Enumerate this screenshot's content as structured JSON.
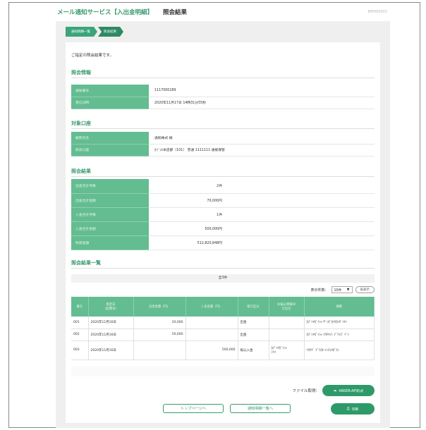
{
  "header": {
    "service_title": "メール通知サービス【入出金明細】",
    "page_title": "照会結果",
    "screen_code": "BMH00003"
  },
  "breadcrumb": [
    "通知明細一覧",
    "照会結果"
  ],
  "intro_text": "ご指定の照会結果です。",
  "sections": {
    "inquiry_info": "照会情報",
    "target_account": "対象口座",
    "inquiry_result": "照会結果",
    "result_list": "照会結果一覧"
  },
  "inquiry_info": [
    {
      "label": "通知番号",
      "value": "1117000189"
    },
    {
      "label": "受信日時",
      "value": "2020年11月17日 14時31分55秒"
    }
  ],
  "target_account": [
    {
      "label": "顧客氏名",
      "value": "通知株式 様"
    },
    {
      "label": "照会口座",
      "value": "ｶﾌﾞｼｷ本店部（101） 普通 1111111 通帳保管"
    }
  ],
  "inquiry_result": [
    {
      "label": "出金合計件数",
      "value": "2件"
    },
    {
      "label": "出金合計金額",
      "value": "70,000円"
    },
    {
      "label": "入金合計件数",
      "value": "1件"
    },
    {
      "label": "入金合計金額",
      "value": "500,000円"
    },
    {
      "label": "残高金額",
      "value": "512,820,848円"
    }
  ],
  "list": {
    "total": "全3件",
    "display_count_label": "表示件数：",
    "display_count_value": "10件",
    "redisplay_label": "再表示",
    "columns": [
      "番号",
      "勘定日\n（起算日）",
      "出金金額（円）",
      "入金金額（円）",
      "取引区分",
      "お振込情報ID\n引出名",
      "摘要"
    ],
    "rows": [
      {
        "no": "001",
        "date": "2020年11月16日",
        "out": "20,000",
        "in": "",
        "type": "出金",
        "info": "",
        "memo": "ｶﾌﾞｼｷｶﾞｲｼｬ ｻﾞﾝﾀﾞｶｿｳｶﾝｾﾞｲｷﾝ"
      },
      {
        "no": "002",
        "date": "2020年11月16日",
        "out": "50,000",
        "in": "",
        "type": "出金",
        "info": "",
        "memo": "ｶﾌﾞｼｷｶﾞｲｼｬ ﾂｳﾁｷｿﾝ ﾌﾞﾗｲｽﾞ ﾍﾟｲ"
      },
      {
        "no": "003",
        "date": "2020年11月16日",
        "out": "",
        "in": "500,000",
        "type": "振込入金",
        "info": "ｶﾌﾞｼｷｶﾞｲｼｬ\nﾐﾂｲ",
        "memo": "ﾂｳﾁｷﾞ ﾌﾟﾗｽﾀｰｲﾝﾁｮｳﾎﾞｳﾆ"
      }
    ]
  },
  "file_label": "ファイル取得：",
  "anser_button": "ANSER-API形式",
  "top_button": "トップページへ",
  "list_button": "通知明細一覧へ",
  "print_button": "印刷",
  "colors": {
    "accent": "#3a9b6e",
    "header_cell": "#63bd90",
    "button": "#2e9a6a"
  }
}
